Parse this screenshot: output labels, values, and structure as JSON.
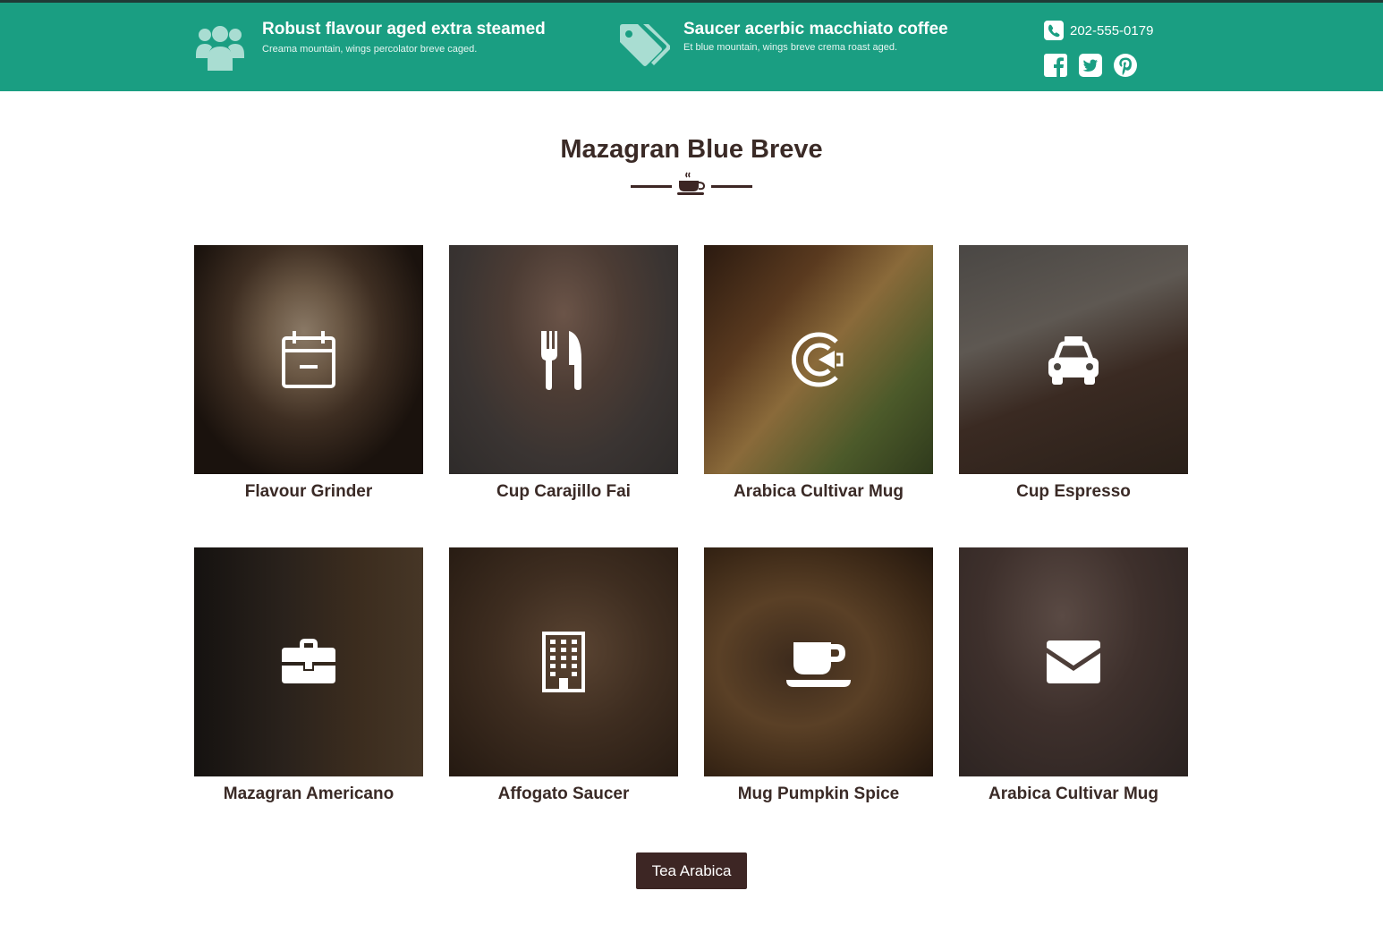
{
  "topbar": {
    "features": [
      {
        "icon": "users-icon",
        "title": "Robust flavour aged extra steamed",
        "subtitle": "Creama mountain, wings percolator breve caged."
      },
      {
        "icon": "tags-icon",
        "title": "Saucer acerbic macchiato coffee",
        "subtitle": "Et blue mountain, wings breve crema roast aged."
      }
    ],
    "phone": "202-555-0179",
    "socials": [
      "facebook-icon",
      "twitter-icon",
      "pinterest-icon"
    ],
    "colors": {
      "background": "#1a9e82",
      "icon": "#a9ddd2"
    }
  },
  "section": {
    "title": "Mazagran Blue Breve",
    "divider_icon": "coffee-cup-icon"
  },
  "cards": [
    {
      "icon": "calendar-icon",
      "label": "Flavour Grinder"
    },
    {
      "icon": "cutlery-icon",
      "label": "Cup Carajillo Fai"
    },
    {
      "icon": "pacman-icon",
      "label": "Arabica Cultivar Mug"
    },
    {
      "icon": "taxi-icon",
      "label": "Cup Espresso"
    },
    {
      "icon": "briefcase-icon",
      "label": "Mazagran Americano"
    },
    {
      "icon": "building-icon",
      "label": "Affogato Saucer"
    },
    {
      "icon": "coffee-icon",
      "label": "Mug Pumpkin Spice"
    },
    {
      "icon": "envelope-icon",
      "label": "Arabica Cultivar Mug"
    }
  ],
  "button": {
    "label": "Tea Arabica"
  },
  "colors": {
    "text": "#3a2a26",
    "button": "#3d2624"
  }
}
